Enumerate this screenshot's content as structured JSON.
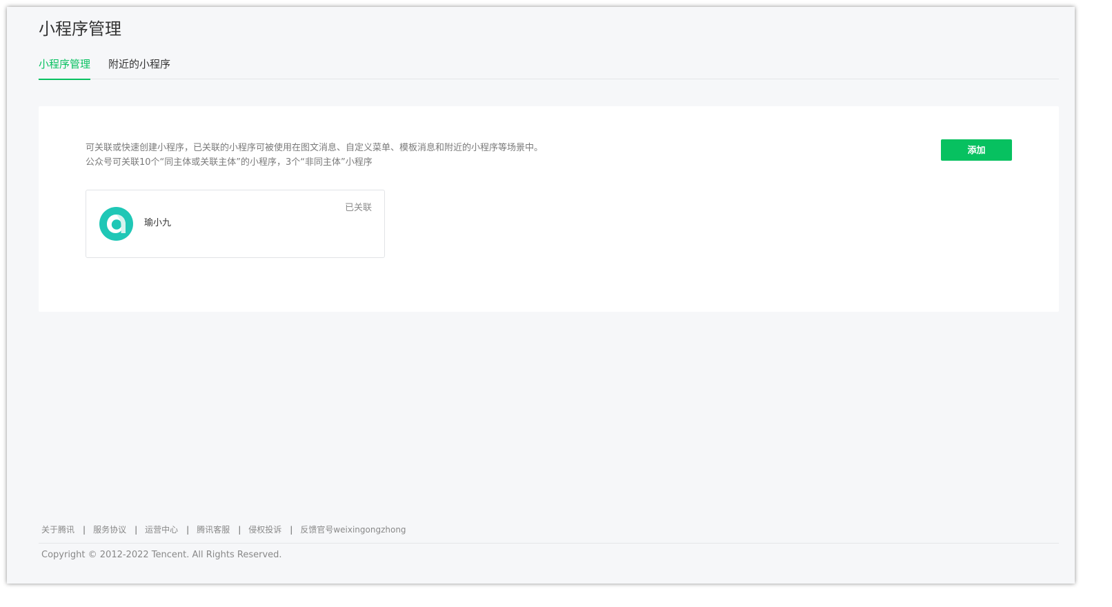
{
  "page": {
    "title": "小程序管理"
  },
  "tabs": [
    {
      "label": "小程序管理",
      "active": true
    },
    {
      "label": "附近的小程序",
      "active": false
    }
  ],
  "panel": {
    "description_line1": "可关联或快速创建小程序，已关联的小程序可被使用在图文消息、自定义菜单、模板消息和附近的小程序等场景中。",
    "description_line2": "公众号可关联10个“同主体或关联主体”的小程序，3个“非同主体”小程序",
    "add_button_label": "添加",
    "mini_programs": [
      {
        "name": "瑜小九",
        "status": "已关联",
        "logo_icon": "app-logo-icon"
      }
    ]
  },
  "footer": {
    "links": [
      "关于腾讯",
      "服务协议",
      "运营中心",
      "腾讯客服",
      "侵权投诉",
      "反馈官号weixingongzhong"
    ],
    "separator": "|",
    "copyright": "Copyright © 2012-2022 Tencent. All Rights Reserved."
  },
  "colors": {
    "accent": "#07c160",
    "logo": "#1fc7b6",
    "background": "#f6f7f9"
  }
}
